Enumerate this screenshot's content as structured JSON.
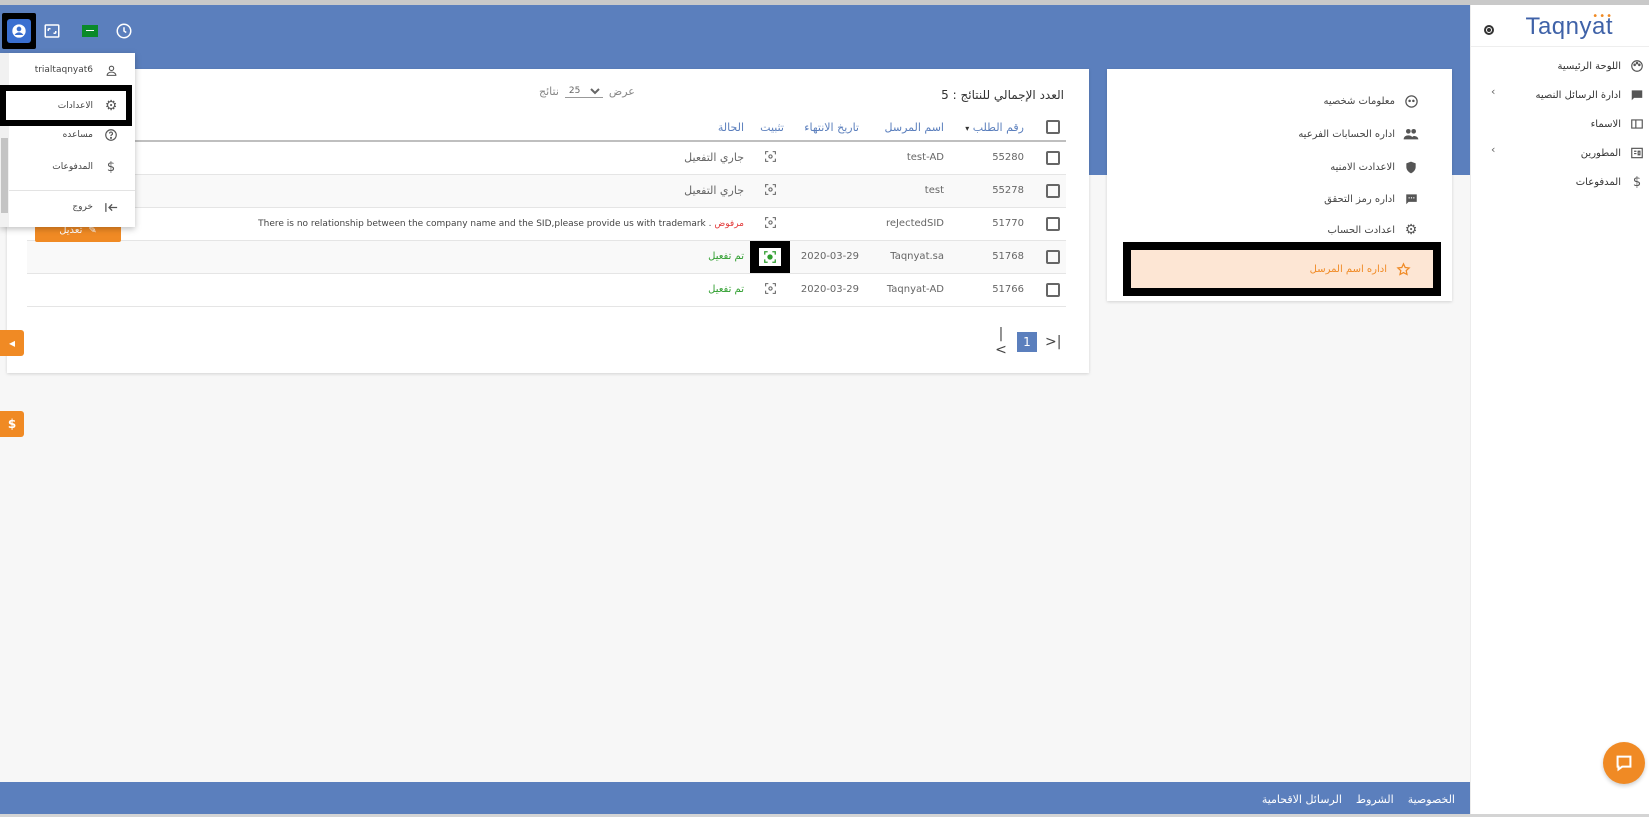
{
  "brand": {
    "name": "Taqnyat",
    "dots": "•••"
  },
  "sidebar": {
    "items": [
      {
        "label": "اللوحة الرئيسية",
        "icon": "palette-icon"
      },
      {
        "label": "ادارة الرسائل النصيه",
        "icon": "message-icon",
        "has_chevron": true
      },
      {
        "label": "الاسماء",
        "icon": "book-icon"
      },
      {
        "label": "المطورين",
        "icon": "api-icon",
        "has_chevron": true
      },
      {
        "label": "المدفوعات",
        "icon": "dollar-icon"
      }
    ]
  },
  "settings_menu": {
    "items": [
      {
        "label": "معلومات شخصيه",
        "icon": "face-icon"
      },
      {
        "label": "اداره الحسابات الفرعيه",
        "icon": "people-icon"
      },
      {
        "label": "الاعدادت الامنيه",
        "icon": "shield-icon"
      },
      {
        "label": "اداره رمز التحقق",
        "icon": "sms-icon"
      },
      {
        "label": "اعدادت الحساب",
        "icon": "gear-icon"
      }
    ],
    "active": {
      "label": "اداره اسم المرسل",
      "icon": "star-icon"
    }
  },
  "results": {
    "total_label": "العدد الإجمالي للنتائج : 5",
    "show_label": "عرض",
    "per_page": "25",
    "per_page_suffix": "نتائج",
    "columns": [
      "رقم الطلب",
      "اسم المرسل",
      "تاريخ الانتهاء",
      "تثبيت",
      "الحالة"
    ],
    "sort_indicator": "▾",
    "rows": [
      {
        "id": "55280",
        "sender": "test-AD",
        "expiry": "",
        "status": "جاري التفعيل",
        "status_type": "pending"
      },
      {
        "id": "55278",
        "sender": "test",
        "expiry": "",
        "status": "جاري التفعيل",
        "status_type": "pending"
      },
      {
        "id": "51770",
        "sender": "reJectedSID",
        "expiry": "",
        "status": "مرفوض",
        "status_type": "rejected",
        "note": "There is no relationship between the company name and the SID,please provide us with trademark ."
      },
      {
        "id": "51768",
        "sender": "Taqnyat.sa",
        "expiry": "2020-03-29",
        "status": "تم تفعيل",
        "status_type": "active",
        "pinned": true
      },
      {
        "id": "51766",
        "sender": "Taqnyat-AD",
        "expiry": "2020-03-29",
        "status": "تم تفعيل",
        "status_type": "active"
      }
    ],
    "pager": {
      "first": "|<",
      "current": "1",
      "last": ">|"
    }
  },
  "edit_button_label": "تعديل",
  "dropdown": {
    "username": "trialtaqnyat6",
    "settings": "الاعدادات",
    "help": "مساعده",
    "payments": "المدفوعات",
    "logout": "خروج"
  },
  "float_tabs": {
    "tab1": "◂",
    "tab2": "$"
  },
  "footer": {
    "links": [
      "الخصوصية",
      "الشروط",
      "الرسائل الاقحامية"
    ]
  },
  "colors": {
    "primary": "#5b7fbd",
    "accent": "#f08a24",
    "active_row_bg": "#fde6d4",
    "success": "#2e9e2e",
    "danger": "#e23b3b"
  }
}
